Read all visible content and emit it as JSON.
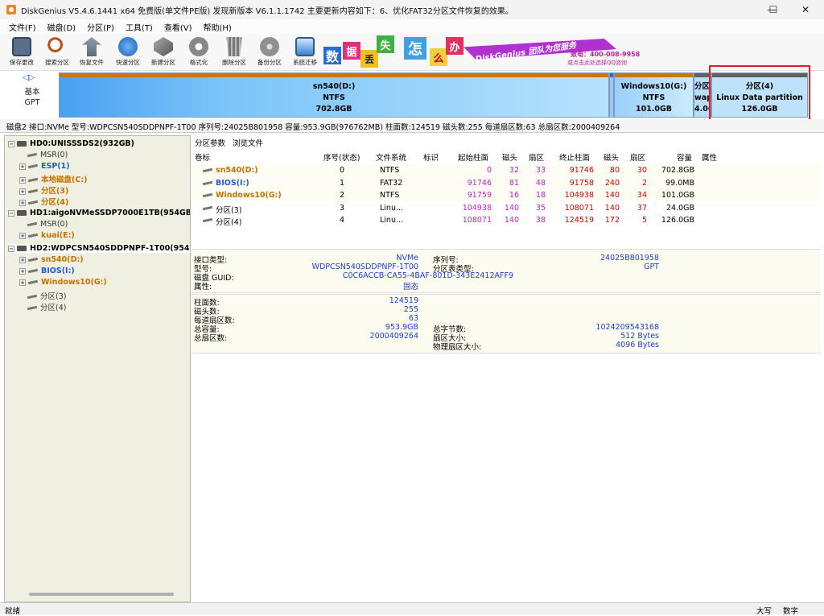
{
  "window": {
    "title": "DiskGenius V5.4.6.1441 x64 免费版(单文件PE版)   发现新版本 V6.1.1.1742   主要更新内容如下：6、优化FAT32分区文件恢复的效果。",
    "min": "—",
    "max": "☐",
    "close": "✕"
  },
  "menu": [
    "文件(F)",
    "磁盘(D)",
    "分区(P)",
    "工具(T)",
    "查看(V)",
    "帮助(H)"
  ],
  "toolbar": [
    {
      "label": "保存更改",
      "icon": "save-icon",
      "color": "#5a6f8a"
    },
    {
      "label": "搜索分区",
      "icon": "search-icon",
      "color": "#c05020"
    },
    {
      "label": "恢复文件",
      "icon": "recover-icon",
      "color": "#607080"
    },
    {
      "label": "快速分区",
      "icon": "quick-partition-icon",
      "color": "#2a6fc8"
    },
    {
      "label": "新建分区",
      "icon": "new-partition-icon",
      "color": "#707070"
    },
    {
      "label": "格式化",
      "icon": "format-icon",
      "color": "#888888"
    },
    {
      "label": "删除分区",
      "icon": "delete-icon",
      "color": "#777777"
    },
    {
      "label": "备份分区",
      "icon": "backup-icon",
      "color": "#909090"
    },
    {
      "label": "系统迁移",
      "icon": "migrate-icon",
      "color": "#3a86d0"
    }
  ],
  "banner": {
    "words": [
      "数",
      "据",
      "丢",
      "失",
      "怎",
      "么",
      "办"
    ],
    "slogan": "DiskGenius 团队为您服务",
    "phone": "致电：400-008-9958",
    "qq": "或点击此处选择QQ咨询"
  },
  "diskmap": {
    "nav_left": "◁",
    "nav_right": "▷",
    "basic": "基本",
    "gpt": "GPT",
    "segments": [
      {
        "l1": "sn540(D:)",
        "l2": "NTFS",
        "l3": "702.8GB"
      },
      {
        "l1": "",
        "l2": "",
        "l3": ""
      },
      {
        "l1": "Windows10(G:)",
        "l2": "NTFS",
        "l3": "101.0GB"
      },
      {
        "l1": "分区(",
        "l2": "wap",
        "l3": "4.0G"
      },
      {
        "l1": "分区(4)",
        "l2": "Linux Data partition",
        "l3": "126.0GB"
      }
    ]
  },
  "diskinfo": "磁盘2 接口:NVMe  型号:WDPCSN540SDDPNPF-1T00  序列号:24025B801958  容量:953.9GB(976762MB)  柱面数:124519  磁头数:255  每道扇区数:63  总扇区数:2000409264",
  "tree": [
    {
      "label": "HD0:UNISSSDS2(932GB)",
      "kind": "disk",
      "exp": "⊟"
    },
    {
      "label": "MSR(0)",
      "kind": "gray",
      "exp": ""
    },
    {
      "label": "ESP(1)",
      "kind": "blue",
      "exp": "⊞"
    },
    {
      "label": "本地磁盘(C:)",
      "kind": "orange",
      "exp": "⊞"
    },
    {
      "label": "分区(3)",
      "kind": "orange",
      "exp": "⊞"
    },
    {
      "label": "分区(4)",
      "kind": "orange",
      "exp": "⊞"
    },
    {
      "label": "HD1:aigoNVMeSSDP7000E1TB(954GB)",
      "kind": "disk",
      "exp": "⊟"
    },
    {
      "label": "MSR(0)",
      "kind": "gray",
      "exp": ""
    },
    {
      "label": "kuai(E:)",
      "kind": "orange",
      "exp": "⊞"
    },
    {
      "label": "HD2:WDPCSN540SDDPNPF-1T00(954G",
      "kind": "disk",
      "exp": "⊟"
    },
    {
      "label": "sn540(D:)",
      "kind": "orange",
      "exp": "⊞"
    },
    {
      "label": "BIOS(I:)",
      "kind": "blue",
      "exp": "⊞"
    },
    {
      "label": "Windows10(G:)",
      "kind": "orange",
      "exp": "⊞"
    },
    {
      "label": "分区(3)",
      "kind": "gray",
      "exp": ""
    },
    {
      "label": "分区(4)",
      "kind": "gray",
      "exp": ""
    }
  ],
  "tabs": [
    "分区参数",
    "浏览文件"
  ],
  "table": {
    "headers": [
      "卷标",
      "序号(状态)",
      "文件系统",
      "标识",
      "起始柱面",
      "磁头",
      "扇区",
      "终止柱面",
      "磁头",
      "扇区",
      "容量",
      "属性"
    ],
    "rows": [
      {
        "name": "sn540(D:)",
        "style": "name-o",
        "num": "0",
        "fs": "NTFS",
        "id": "",
        "sc": "0",
        "sh": "32",
        "ss": "33",
        "ec": "91746",
        "eh": "80",
        "es": "30",
        "size": "702.8GB",
        "attr": ""
      },
      {
        "name": "BIOS(I:)",
        "style": "name-b",
        "num": "1",
        "fs": "FAT32",
        "id": "",
        "sc": "91746",
        "sh": "81",
        "ss": "48",
        "ec": "91758",
        "eh": "240",
        "es": "2",
        "size": "99.0MB",
        "attr": ""
      },
      {
        "name": "Windows10(G:)",
        "style": "name-o",
        "num": "2",
        "fs": "NTFS",
        "id": "",
        "sc": "91759",
        "sh": "16",
        "ss": "18",
        "ec": "104938",
        "eh": "140",
        "es": "34",
        "size": "101.0GB",
        "attr": ""
      },
      {
        "name": "分区(3)",
        "style": "",
        "num": "3",
        "fs": "Linu...",
        "id": "",
        "sc": "104938",
        "sh": "140",
        "ss": "35",
        "ec": "108071",
        "eh": "140",
        "es": "37",
        "size": "24.0GB",
        "attr": ""
      },
      {
        "name": "分区(4)",
        "style": "",
        "num": "4",
        "fs": "Linu...",
        "id": "",
        "sc": "108071",
        "sh": "140",
        "ss": "38",
        "ec": "124519",
        "eh": "172",
        "es": "5",
        "size": "126.0GB",
        "attr": ""
      }
    ]
  },
  "info1": {
    "left": [
      {
        "k": "接口类型:",
        "v": "NVMe"
      },
      {
        "k": "型号:",
        "v": "WDPCSN540SDDPNPF-1T00"
      },
      {
        "k": "磁盘 GUID:",
        "v": "C0C6ACCB-CA55-4BAF-801D-343E2412AFF9"
      },
      {
        "k": "属性:",
        "v": "固态"
      }
    ],
    "right": [
      {
        "k": "序列号:",
        "v": "24025B801958"
      },
      {
        "k": "分区表类型:",
        "v": "GPT"
      }
    ]
  },
  "info2": {
    "left": [
      {
        "k": "柱面数:",
        "v": "124519"
      },
      {
        "k": "磁头数:",
        "v": "255"
      },
      {
        "k": "每道扇区数:",
        "v": "63"
      },
      {
        "k": "总容量:",
        "v": "953.9GB"
      },
      {
        "k": "总扇区数:",
        "v": "2000409264"
      }
    ],
    "right": [
      {
        "k": "总字节数:",
        "v": "1024209543168"
      },
      {
        "k": "扇区大小:",
        "v": "512 Bytes"
      },
      {
        "k": "物理扇区大小:",
        "v": "4096 Bytes"
      }
    ]
  },
  "status": {
    "left": "就绪",
    "caps": "大写",
    "num": "数字"
  }
}
